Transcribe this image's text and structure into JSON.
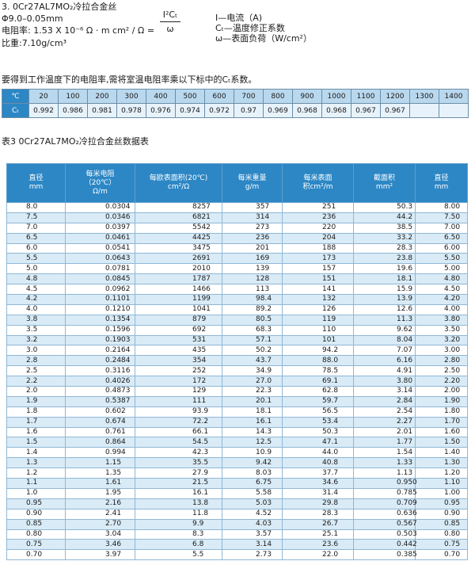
{
  "spec": {
    "line1": "3. 0Cr27AL7MO₂冷拉合金丝",
    "line2": "Φ9.0–0.05mm",
    "line3": "电阻率: 1.53 X 10⁻⁶ Ω · m  cm² / Ω =",
    "line4": "比重:7.10g/cm³",
    "formula_num": "I²Cₜ",
    "formula_den": "ω",
    "legend": [
      "I—电流（A)",
      "Cₜ—温度修正系数",
      "ω—表面负荷（W/cm²）"
    ]
  },
  "note": "要得到工作温度下的电阻率,需将室温电阻率乘以下标中的Cₜ系数。",
  "coef_table": {
    "temp_label": "℃",
    "coef_label": "Cₜ",
    "temps": [
      "20",
      "100",
      "200",
      "300",
      "400",
      "500",
      "600",
      "700",
      "800",
      "900",
      "1000",
      "1100",
      "1200",
      "1300",
      "1400"
    ],
    "values": [
      "0.992",
      "0.986",
      "0.981",
      "0.978",
      "0.976",
      "0.974",
      "0.972",
      "0.97",
      "0.969",
      "0.968",
      "0.968",
      "0.967",
      "0.967",
      "",
      ""
    ]
  },
  "table3_title": "表3  0Cr27AL7MO₂冷拉合金丝数据表",
  "main_table": {
    "headers": [
      [
        "直径",
        "mm"
      ],
      [
        "每米电阻",
        "（20℃）",
        "Ω/m"
      ],
      [
        "每欧表面积(20℃)",
        "cm²/Ω"
      ],
      [
        "每米重量",
        "g/m"
      ],
      [
        "每米表面",
        "积cm²/m"
      ],
      [
        "截面积",
        "mm²"
      ],
      [
        "直径",
        "mm"
      ]
    ],
    "rows": [
      [
        "8.0",
        "0.0304",
        "8257",
        "357",
        "251",
        "50.3",
        "8.00"
      ],
      [
        "7.5",
        "0.0346",
        "6821",
        "314",
        "236",
        "44.2",
        "7.50"
      ],
      [
        "7.0",
        "0.0397",
        "5542",
        "273",
        "220",
        "38.5",
        "7.00"
      ],
      [
        "6.5",
        "0.0461",
        "4425",
        "236",
        "204",
        "33.2",
        "6.50"
      ],
      [
        "6.0",
        "0.0541",
        "3475",
        "201",
        "188",
        "28.3",
        "6.00"
      ],
      [
        "5.5",
        "0.0643",
        "2691",
        "169",
        "173",
        "23.8",
        "5.50"
      ],
      [
        "5.0",
        "0.0781",
        "2010",
        "139",
        "157",
        "19.6",
        "5.00"
      ],
      [
        "4.8",
        "0.0845",
        "1787",
        "128",
        "151",
        "18.1",
        "4.80"
      ],
      [
        "4.5",
        "0.0962",
        "1466",
        "113",
        "141",
        "15.9",
        "4.50"
      ],
      [
        "4.2",
        "0.1101",
        "1199",
        "98.4",
        "132",
        "13.9",
        "4.20"
      ],
      [
        "4.0",
        "0.1210",
        "1041",
        "89.2",
        "126",
        "12.6",
        "4.00"
      ],
      [
        "3.8",
        "0.1354",
        "879",
        "80.5",
        "119",
        "11.3",
        "3.80"
      ],
      [
        "3.5",
        "0.1596",
        "692",
        "68.3",
        "110",
        "9.62",
        "3.50"
      ],
      [
        "3.2",
        "0.1903",
        "531",
        "57.1",
        "101",
        "8.04",
        "3.20"
      ],
      [
        "3.0",
        "0.2164",
        "435",
        "50.2",
        "94.2",
        "7.07",
        "3.00"
      ],
      [
        "2.8",
        "0.2484",
        "354",
        "43.7",
        "88.0",
        "6.16",
        "2.80"
      ],
      [
        "2.5",
        "0.3116",
        "252",
        "34.9",
        "78.5",
        "4.91",
        "2.50"
      ],
      [
        "2.2",
        "0.4026",
        "172",
        "27.0",
        "69.1",
        "3.80",
        "2.20"
      ],
      [
        "2.0",
        "0.4873",
        "129",
        "22.3",
        "62.8",
        "3.14",
        "2.00"
      ],
      [
        "1.9",
        "0.5387",
        "111",
        "20.1",
        "59.7",
        "2.84",
        "1.90"
      ],
      [
        "1.8",
        "0.602",
        "93.9",
        "18.1",
        "56.5",
        "2.54",
        "1.80"
      ],
      [
        "1.7",
        "0.674",
        "72.2",
        "16.1",
        "53.4",
        "2.27",
        "1.70"
      ],
      [
        "1.6",
        "0.761",
        "66.1",
        "14.3",
        "50.3",
        "2.01",
        "1.60"
      ],
      [
        "1.5",
        "0.864",
        "54.5",
        "12.5",
        "47.1",
        "1.77",
        "1.50"
      ],
      [
        "1.4",
        "0.994",
        "42.3",
        "10.9",
        "44.0",
        "1.54",
        "1.40"
      ],
      [
        "1.3",
        "1.15",
        "35.5",
        "9.42",
        "40.8",
        "1.33",
        "1.30"
      ],
      [
        "1.2",
        "1.35",
        "27.9",
        "8.03",
        "37.7",
        "1.13",
        "1.20"
      ],
      [
        "1.1",
        "1.61",
        "21.5",
        "6.75",
        "34.6",
        "0.950",
        "1.10"
      ],
      [
        "1.0",
        "1.95",
        "16.1",
        "5.58",
        "31.4",
        "0.785",
        "1.00"
      ],
      [
        "0.95",
        "2.16",
        "13.8",
        "5.03",
        "29.8",
        "0.709",
        "0.95"
      ],
      [
        "0.90",
        "2.41",
        "11.8",
        "4.52",
        "28.3",
        "0.636",
        "0.90"
      ],
      [
        "0.85",
        "2.70",
        "9.9",
        "4.03",
        "26.7",
        "0.567",
        "0.85"
      ],
      [
        "0.80",
        "3.04",
        "8.3",
        "3.57",
        "25.1",
        "0.503",
        "0.80"
      ],
      [
        "0.75",
        "3.46",
        "6.8",
        "3.14",
        "23.6",
        "0.442",
        "0.75"
      ],
      [
        "0.70",
        "3.97",
        "5.5",
        "2.73",
        "22.0",
        "0.385",
        "0.70"
      ]
    ]
  }
}
